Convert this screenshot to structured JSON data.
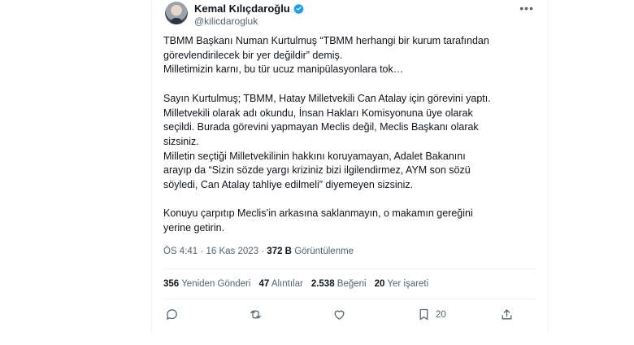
{
  "user": {
    "name": "Kemal Kılıçdaroğlu",
    "handle": "@kilicdarogluk"
  },
  "tweet": {
    "lines": [
      "TBMM Başkanı Numan Kurtulmuş “TBMM herhangi bir kurum tarafından",
      "görevlendirilecek bir yer değildir” demiş.",
      "Milletimizin karnı, bu tür ucuz manipülasyonlara tok…",
      "",
      "Sayın Kurtulmuş; TBMM, Hatay Milletvekili Can Atalay için görevini yaptı.",
      "Milletvekili olarak adı okundu, İnsan Hakları Komisyonuna üye olarak",
      "seçildi. Burada görevini yapmayan Meclis değil, Meclis Başkanı olarak",
      "sizsiniz.",
      "Milletin seçtiği Milletvekilinin hakkını koruyamayan, Adalet Bakanını",
      "arayıp da “Sizin sözde yargı kriziniz bizi ilgilendirmez, AYM son sözü",
      "söyledi, Can Atalay tahliye edilmeli” diyemeyen sizsiniz.",
      "",
      "Konuyu çarpıtıp Meclis’in arkasına saklanmayın, o makamın gereğini",
      "yerine getirin."
    ],
    "time": "ÖS 4:41",
    "separator": "·",
    "date": "16 Kas 2023",
    "views_count": "372 B",
    "views_label": "Görüntülenme"
  },
  "stats": {
    "retweets_count": "356",
    "retweets_label": "Yeniden Gönderi",
    "quotes_count": "47",
    "quotes_label": "Alıntılar",
    "likes_count": "2.538",
    "likes_label": "Beğeni",
    "bookmarks_count": "20",
    "bookmarks_label": "Yer işareti"
  },
  "actions": {
    "bookmark_count": "20"
  },
  "icons": {
    "verified": "verified-badge-icon",
    "more": "more-icon",
    "reply": "reply-icon",
    "retweet": "retweet-icon",
    "like": "heart-icon",
    "bookmark": "bookmark-icon",
    "share": "share-icon"
  },
  "colors": {
    "text": "#0f1419",
    "secondary": "#536471",
    "verified": "#1d9bf0",
    "border": "#eff3f4"
  }
}
